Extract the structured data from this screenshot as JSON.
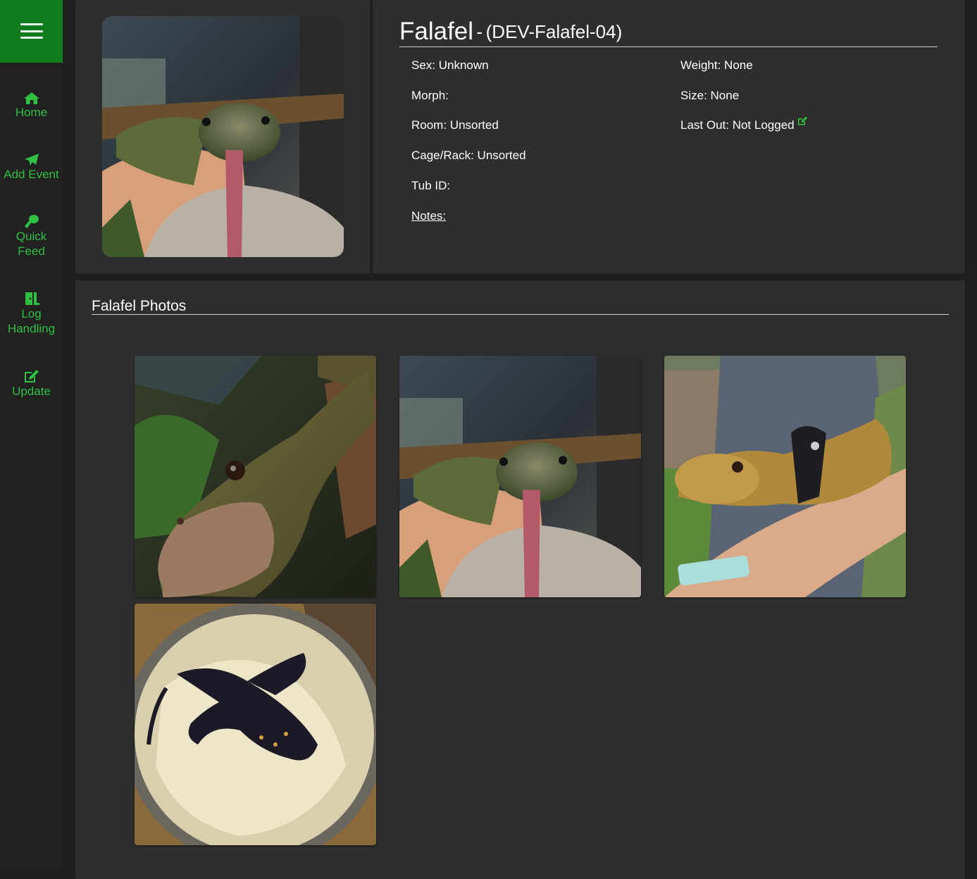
{
  "sidebar": {
    "items": [
      {
        "label": "Home",
        "icon": "home-icon"
      },
      {
        "label": "Add Event",
        "icon": "paper-plane-icon"
      },
      {
        "label": "Quick Feed",
        "icon": "drumstick-icon"
      },
      {
        "label": "Log Handling",
        "icon": "door-exit-icon"
      },
      {
        "label": "Update",
        "icon": "edit-icon"
      }
    ]
  },
  "animal": {
    "name": "Falafel",
    "separator": "-",
    "code": "(DEV-Falafel-04)",
    "fields": {
      "sex": "Sex: Unknown",
      "morph": "Morph:",
      "room": "Room: Unsorted",
      "cage_rack": "Cage/Rack: Unsorted",
      "tub_id": "Tub ID:",
      "notes": "Notes:",
      "weight": "Weight: None",
      "size": "Size: None",
      "last_out": "Last Out: Not Logged"
    }
  },
  "photos": {
    "title": "Falafel Photos",
    "items": [
      {
        "subject": "lizard-closeup"
      },
      {
        "subject": "lizard-tongue"
      },
      {
        "subject": "lizard-harness"
      },
      {
        "subject": "lizard-container"
      }
    ]
  },
  "colors": {
    "accent": "#2fc043",
    "menu_bg": "#0e7c1d",
    "panel_bg": "#2e2e2e",
    "page_bg": "#1f1f1f",
    "sidebar_bg": "#212121"
  }
}
